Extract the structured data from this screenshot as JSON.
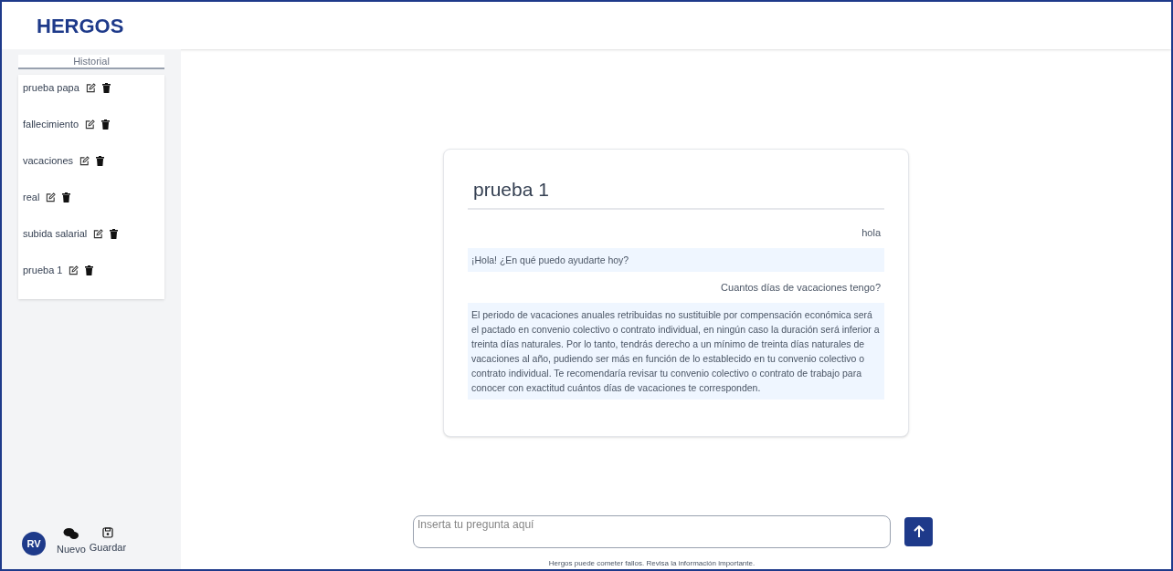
{
  "app": {
    "logo": "HERGOS"
  },
  "sidebar": {
    "history_title": "Historial",
    "items": [
      {
        "label": "prueba papa"
      },
      {
        "label": "fallecimiento"
      },
      {
        "label": "vacaciones"
      },
      {
        "label": "real"
      },
      {
        "label": "subida salarial"
      },
      {
        "label": "prueba 1"
      }
    ],
    "user_initials": "RV",
    "actions": [
      {
        "kind": "new",
        "label": "Nuevo"
      },
      {
        "kind": "save",
        "label": "Guardar"
      }
    ]
  },
  "chat": {
    "title": "prueba 1",
    "messages": [
      {
        "kind": "user",
        "text": "hola"
      },
      {
        "kind": "bot",
        "text": "¡Hola! ¿En qué puedo ayudarte hoy?"
      },
      {
        "kind": "user",
        "text": "Cuantos días de vacaciones tengo?"
      },
      {
        "kind": "bot",
        "text": "El periodo de vacaciones anuales retribuidas no sustituible por compensación económica será el pactado en convenio colectivo o contrato individual, en ningún caso la duración será inferior a treinta días naturales. Por lo tanto, tendrás derecho a un mínimo de treinta días naturales de vacaciones al año, pudiendo ser más en función de lo establecido en tu convenio colectivo o contrato individual. Te recomendaría revisar tu convenio colectivo o contrato de trabajo para conocer con exactitud cuántos días de vacaciones te corresponden."
      }
    ]
  },
  "composer": {
    "placeholder": "Inserta tu pregunta aquí",
    "disclaimer": "Hergos puede cometer fallos. Revisa la información importante."
  }
}
